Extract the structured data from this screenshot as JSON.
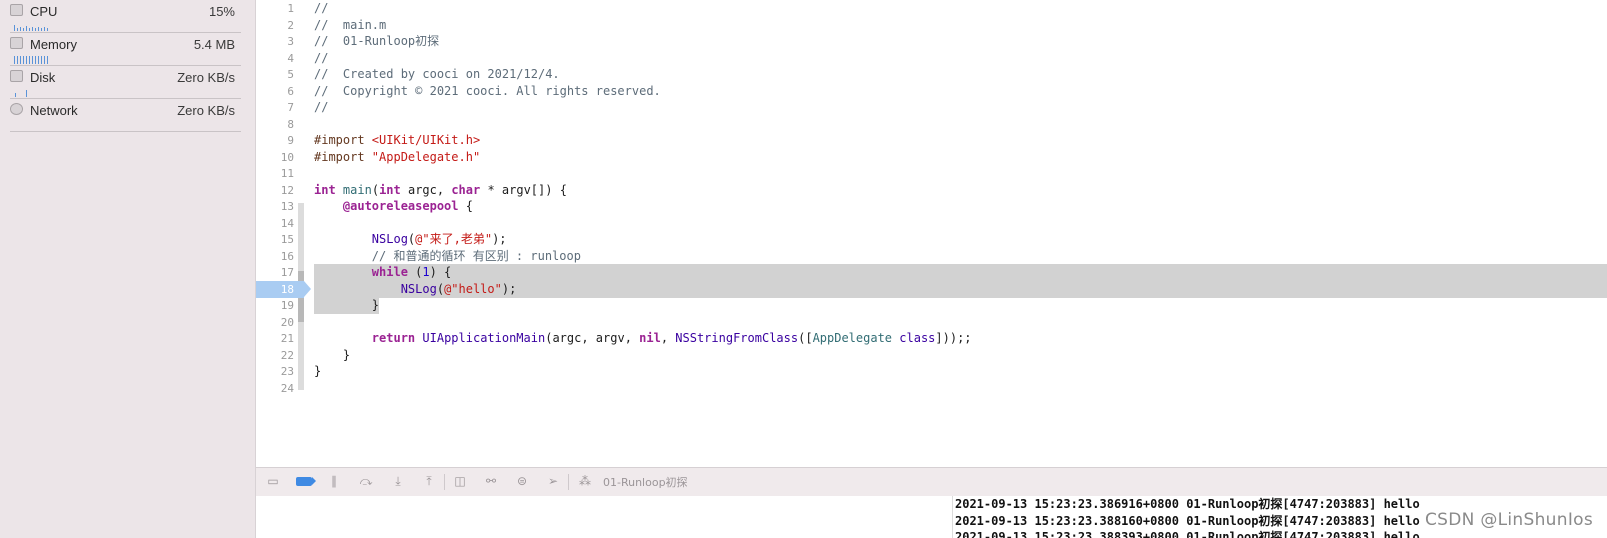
{
  "navigator": {
    "gauges": [
      {
        "label": "CPU",
        "value": "15%",
        "icon": "cpu-icon"
      },
      {
        "label": "Memory",
        "value": "5.4 MB",
        "icon": "memory-icon"
      },
      {
        "label": "Disk",
        "value": "Zero KB/s",
        "icon": "disk-icon"
      },
      {
        "label": "Network",
        "value": "Zero KB/s",
        "icon": "network-icon"
      }
    ]
  },
  "editor": {
    "current_line": 18,
    "lines": [
      {
        "n": "1",
        "tokens": [
          {
            "t": "//",
            "c": "cm"
          }
        ]
      },
      {
        "n": "2",
        "tokens": [
          {
            "t": "//  main.m",
            "c": "cm"
          }
        ]
      },
      {
        "n": "3",
        "tokens": [
          {
            "t": "//  01-Runloop初探",
            "c": "cm"
          }
        ]
      },
      {
        "n": "4",
        "tokens": [
          {
            "t": "//",
            "c": "cm"
          }
        ]
      },
      {
        "n": "5",
        "tokens": [
          {
            "t": "//  Created by cooci on 2021/12/4.",
            "c": "cm"
          }
        ]
      },
      {
        "n": "6",
        "tokens": [
          {
            "t": "//  Copyright © 2021 cooci. All rights reserved.",
            "c": "cm"
          }
        ]
      },
      {
        "n": "7",
        "tokens": [
          {
            "t": "//",
            "c": "cm"
          }
        ]
      },
      {
        "n": "8",
        "tokens": []
      },
      {
        "n": "9",
        "tokens": [
          {
            "t": "#import ",
            "c": "pp"
          },
          {
            "t": "<UIKit/UIKit.h>",
            "c": "str"
          }
        ]
      },
      {
        "n": "10",
        "tokens": [
          {
            "t": "#import ",
            "c": "pp"
          },
          {
            "t": "\"AppDelegate.h\"",
            "c": "str"
          }
        ]
      },
      {
        "n": "11",
        "tokens": []
      },
      {
        "n": "12",
        "tokens": [
          {
            "t": "int",
            "c": "kw"
          },
          {
            "t": " ",
            "c": "plain"
          },
          {
            "t": "main",
            "c": "fn"
          },
          {
            "t": "(",
            "c": "plain"
          },
          {
            "t": "int",
            "c": "kw"
          },
          {
            "t": " argc, ",
            "c": "plain"
          },
          {
            "t": "char",
            "c": "kw"
          },
          {
            "t": " * argv[]) {",
            "c": "plain"
          }
        ]
      },
      {
        "n": "13",
        "tokens": [
          {
            "t": "    ",
            "c": "plain"
          },
          {
            "t": "@autoreleasepool",
            "c": "kw"
          },
          {
            "t": " {",
            "c": "plain"
          }
        ]
      },
      {
        "n": "14",
        "tokens": []
      },
      {
        "n": "15",
        "tokens": [
          {
            "t": "        ",
            "c": "plain"
          },
          {
            "t": "NSLog",
            "c": "cls"
          },
          {
            "t": "(",
            "c": "plain"
          },
          {
            "t": "@\"来了,老弟\"",
            "c": "str"
          },
          {
            "t": ");",
            "c": "plain"
          }
        ]
      },
      {
        "n": "16",
        "tokens": [
          {
            "t": "        // 和普通的循环 有区别 : runloop",
            "c": "cm"
          }
        ]
      },
      {
        "n": "17",
        "tokens": [
          {
            "t": "        ",
            "c": "plain"
          },
          {
            "t": "while",
            "c": "kw"
          },
          {
            "t": " (",
            "c": "plain"
          },
          {
            "t": "1",
            "c": "num"
          },
          {
            "t": ") {",
            "c": "plain"
          }
        ]
      },
      {
        "n": "18",
        "tokens": [
          {
            "t": "            ",
            "c": "plain"
          },
          {
            "t": "NSLog",
            "c": "cls"
          },
          {
            "t": "(",
            "c": "plain"
          },
          {
            "t": "@\"hello\"",
            "c": "str"
          },
          {
            "t": ");",
            "c": "plain"
          }
        ]
      },
      {
        "n": "19",
        "tokens": [
          {
            "t": "        }",
            "c": "plain"
          }
        ]
      },
      {
        "n": "20",
        "tokens": []
      },
      {
        "n": "21",
        "tokens": [
          {
            "t": "        ",
            "c": "plain"
          },
          {
            "t": "return",
            "c": "kw"
          },
          {
            "t": " ",
            "c": "plain"
          },
          {
            "t": "UIApplicationMain",
            "c": "cls"
          },
          {
            "t": "(argc, argv, ",
            "c": "plain"
          },
          {
            "t": "nil",
            "c": "kw"
          },
          {
            "t": ", ",
            "c": "plain"
          },
          {
            "t": "NSStringFromClass",
            "c": "cls"
          },
          {
            "t": "([",
            "c": "plain"
          },
          {
            "t": "AppDelegate",
            "c": "fn"
          },
          {
            "t": " ",
            "c": "plain"
          },
          {
            "t": "class",
            "c": "cls"
          },
          {
            "t": "]));;",
            "c": "plain"
          }
        ]
      },
      {
        "n": "22",
        "tokens": [
          {
            "t": "    }",
            "c": "plain"
          }
        ]
      },
      {
        "n": "23",
        "tokens": [
          {
            "t": "}",
            "c": "plain"
          }
        ]
      },
      {
        "n": "24",
        "tokens": []
      }
    ]
  },
  "debugbar": {
    "target_label": "01-Runloop初探"
  },
  "console": {
    "lines": [
      "2021-09-13 15:23:23.386916+0800 01-Runloop初探[4747:203883] hello",
      "2021-09-13 15:23:23.388160+0800 01-Runloop初探[4747:203883] hello",
      "2021-09-13 15:23:23.388393+0800 01-Runloop初探[4747:203883] hello"
    ]
  },
  "watermark": "CSDN @LinShunIos",
  "colors": {
    "navigator_bg": "#ece5e8",
    "selection": "#d2d2d2",
    "current_line_marker": "#a9ccf2",
    "accent": "#3f8ae3"
  }
}
